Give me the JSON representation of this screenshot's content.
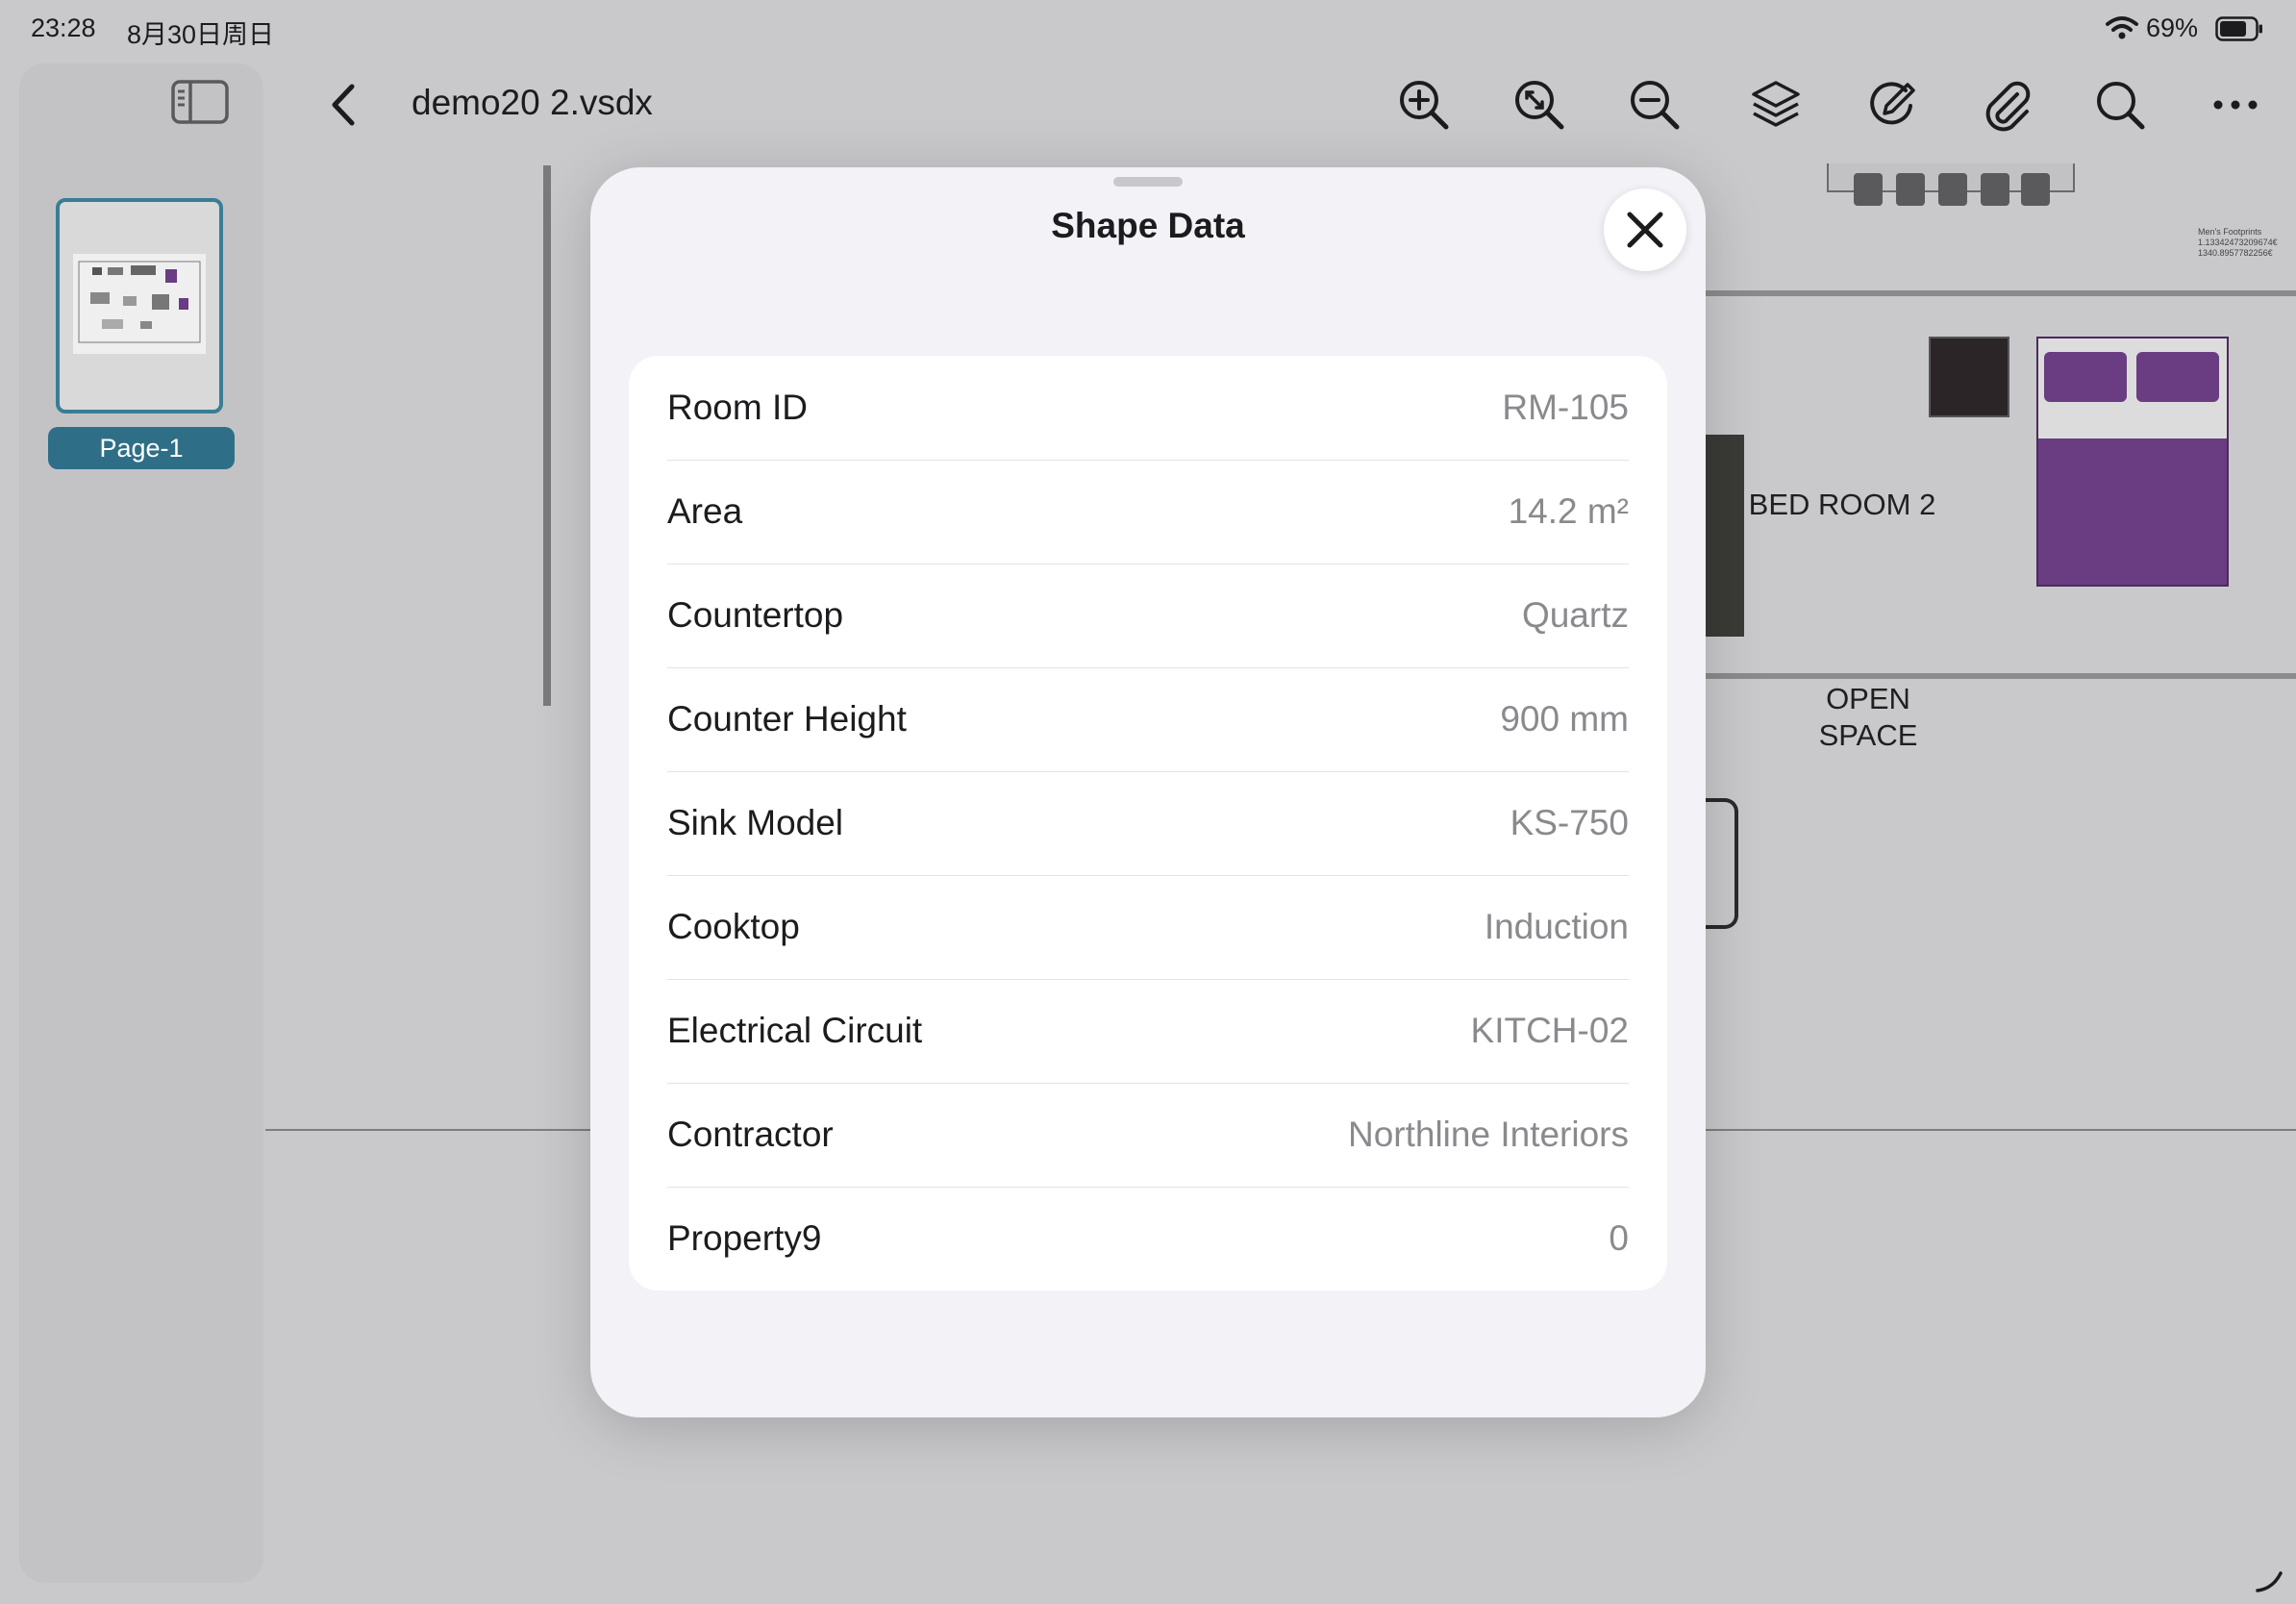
{
  "status_bar": {
    "time": "23:28",
    "date": "8月30日周日",
    "battery_percent": "69%"
  },
  "sidebar": {
    "pages": [
      {
        "label": "Page-1",
        "selected": true
      }
    ]
  },
  "toolbar": {
    "title": "demo20 2.vsdx",
    "icons": [
      "back-chevron-icon",
      "zoom-in-icon",
      "zoom-fit-icon",
      "zoom-out-icon",
      "layers-icon",
      "markup-icon",
      "attachment-icon",
      "search-icon",
      "more-icon"
    ]
  },
  "canvas": {
    "room_label_1": "BED ROOM 2",
    "room_label_2": "OPEN SPACE",
    "footprint_note": [
      "Men's Footprints",
      "1.13342473209674€",
      "1340.8957782256€"
    ],
    "accent_purple": "#6a3c82"
  },
  "sheet": {
    "title": "Shape Data",
    "rows": [
      {
        "key": "Room ID",
        "value": "RM-105"
      },
      {
        "key": "Area",
        "value": "14.2 m²"
      },
      {
        "key": "Countertop",
        "value": "Quartz"
      },
      {
        "key": "Counter Height",
        "value": "900 mm"
      },
      {
        "key": "Sink Model",
        "value": "KS-750"
      },
      {
        "key": "Cooktop",
        "value": "Induction"
      },
      {
        "key": "Electrical Circuit",
        "value": "KITCH-02"
      },
      {
        "key": "Contractor",
        "value": "Northline Interiors"
      },
      {
        "key": "Property9",
        "value": "0"
      }
    ]
  }
}
